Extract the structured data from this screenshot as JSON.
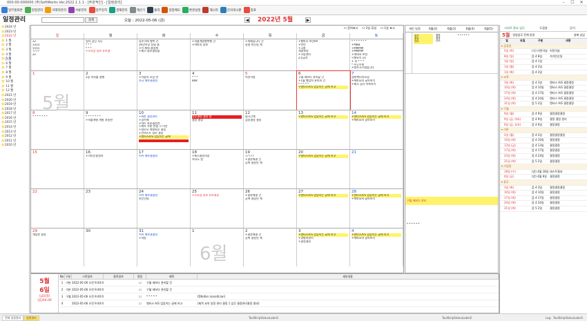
{
  "window": {
    "title": "000-00-000000 (주)SoftWorks Ver.2022.1.1.1 - [주관적인] - [일정관리]"
  },
  "toolbar": [
    "업무홈화면",
    "일정관리",
    "거래처관리",
    "서류관리",
    "업무일지",
    "결재관리",
    "계산기",
    "출력",
    "일정메모",
    "환경설정",
    "재시작",
    "문의게시판",
    "종료"
  ],
  "app": {
    "title": "일정관리",
    "today": "오늘 : 2022-05-06 (금)",
    "month_title": "2022년 5월",
    "prev": "◀",
    "next": "▶"
  },
  "search": {
    "button": "검색"
  },
  "cal_options": [
    "음력표시",
    "2일 휴일",
    "1일 표시"
  ],
  "weekdays": [
    "일",
    "월",
    "화",
    "수",
    "목",
    "금",
    "토"
  ],
  "sidebar": {
    "items": [
      "2024 년",
      "2023 년",
      "2022 년",
      "  1 월",
      "  2 월",
      "  3 월",
      "  4 월",
      "  5 월",
      "  6 월",
      "  7 월",
      "  8 월",
      "  9 월",
      "  10 월",
      "  11 월",
      "  12 월",
      "2021 년",
      "2020 년",
      "2019 년",
      "2018 년",
      "2017 년",
      "2016 년",
      "2015 년",
      "2014 년",
      "2013 년",
      "2012 년",
      "2011 년",
      "2010 년"
    ]
  },
  "weeks": [
    [
      {
        "d": "",
        "ev": [
          "22",
          "3333",
          "5555",
          "7777",
          "22"
        ]
      },
      {
        "d": "",
        "ev": [
          "일자 검진 사무",
          "* * *",
          "* * *",
          "+오사업 일보 유보결"
        ]
      },
      {
        "d": "",
        "ev": [
          "일주이에 행복 건",
          "26년이상 정밀 결",
          "+이 제대 결정계",
          "+제시 종료결정을"
        ]
      },
      {
        "d": "",
        "ev": [
          "+의를개발행복행 건",
          "+마마의 정보"
        ]
      },
      {
        "d": "",
        "ev": [
          "+개제입니다 건",
          "장철 미진일 계"
        ]
      },
      {
        "d": "",
        "ev": [
          "+행마다 보안9A",
          "+반언",
          "+국종",
          "개영보정",
          "+고함센터",
          "2고급석"
        ]
      },
      {
        "d": "",
        "ev": [
          "* * * * * * *",
          "+MBB",
          "+MMMM",
          "+MMMM",
          "+세대서 보정",
          "<행유이 10",
          "+ 요 * * *",
          "* 주무수계",
          "+발학시스템입니다"
        ]
      }
    ],
    [
      {
        "d": "1",
        "red": true,
        "ev": []
      },
      {
        "d": "2",
        "ev": [
          "2일 의지를 결행"
        ]
      },
      {
        "d": "3",
        "ev": [
          "+먹중의 모임 면",
          "의국 해보결결정"
        ]
      },
      {
        "d": "4",
        "ev": [
          "* * *",
          "888"
        ]
      },
      {
        "d": "5",
        "red": true,
        "ev": [
          "어린이날"
        ]
      },
      {
        "d": "6",
        "ev": [
          "구월 헤보다 관리할 건",
          "+1월 행업자 관리의 건",
          "* * * * *",
          "+엔터스A/S 업있이는 글에 하고"
        ]
      },
      {
        "d": "7",
        "ev": [
          "경현책더라모업",
          "+에마요의 골목보기",
          "+제시 검사 목록하기"
        ]
      }
    ],
    [
      {
        "d": "8",
        "red": true,
        "ev": [
          "* * * * * * *"
        ]
      },
      {
        "d": "9",
        "ev": [
          "* * * * * * *",
          "+의를개발 개발 과일한"
        ]
      },
      {
        "d": "10",
        "ev": [
          "+위한 결정관리",
          "+경기에",
          "+마트 자료결정면",
          "+제목 가항 연결 그 이전",
          "+설은모 개발되신 결정",
          "+컨텍스트 정리 결정",
          "+엔터스A/S 업있이는 글에"
        ]
      },
      {
        "d": "11",
        "ev": [
          "업무결정 결정 날",
          "결정 결정"
        ]
      },
      {
        "d": "12",
        "ev": [
          "필시간계",
          "검정결정 결정"
        ]
      },
      {
        "d": "13",
        "ev": [
          "+엔터스A/S 업있이는 글에 하고"
        ]
      },
      {
        "d": "14",
        "ev": [
          "+엔터스A/S 업있이는 글에 하고",
          "+에마요의 골목보기"
        ]
      }
    ],
    [
      {
        "d": "15",
        "red": true,
        "ev": []
      },
      {
        "d": "16",
        "ev": [
          "+기라운용원자"
        ]
      },
      {
        "d": "17",
        "ev": [
          "이커 해보결결정"
        ]
      },
      {
        "d": "18",
        "ev": [
          "+제시결정의정",
          "의사도 원"
        ]
      },
      {
        "d": "19",
        "ev": [
          "77777",
          "+결정해결 건",
          "공책 결정된 계"
        ]
      },
      {
        "d": "20",
        "ev": [
          "+엔터스A/S 업있이는 글에 하고"
        ]
      },
      {
        "d": "21",
        "ev": []
      }
    ],
    [
      {
        "d": "22",
        "red": true,
        "ev": []
      },
      {
        "d": "23",
        "ev": []
      },
      {
        "d": "24",
        "ev": [
          "이커 해보결결정",
          "연진인원"
        ]
      },
      {
        "d": "25",
        "ev": [
          "+오사업 일보 유보결정"
        ]
      },
      {
        "d": "26",
        "ev": [
          "+결정해결 건",
          "공책 결정된 계"
        ]
      },
      {
        "d": "27",
        "ev": [
          "+엔터스A/S 업있이는 글에 하고"
        ]
      },
      {
        "d": "28",
        "ev": [
          "+엔터스A/S 업있이는 글에 하고",
          "+에마요의 골목보기"
        ]
      }
    ],
    [
      {
        "d": "29",
        "red": true,
        "ev": [
          "개업한 결정"
        ]
      },
      {
        "d": "30",
        "ev": []
      },
      {
        "d": "31",
        "ev": [
          "이커 해보결결정",
          "+의원"
        ]
      },
      {
        "d": "1",
        "ev": []
      },
      {
        "d": "2",
        "ev": [
          "+결정해결 건",
          "공책 결정된 계"
        ]
      },
      {
        "d": "3",
        "ev": [
          "+엔터스A/S 업있이는 글에 하고",
          "+경험과관리",
          "+결정결정"
        ]
      },
      {
        "d": "4",
        "ev": [
          "+엔터스A/S 업있이는 글에 하고",
          "+에마요의 골목보기"
        ]
      }
    ]
  ],
  "big_months": {
    "may": "5월",
    "june": "6월"
  },
  "midpanel": {
    "headers": [
      "개인 일정",
      "6월(2)",
      "6월(3)",
      "6월(4)",
      "6월(5)"
    ],
    "sel": "6월(2)",
    "opt": "7일"
  },
  "rightpanel": {
    "month": "5월",
    "title": "일일업무 전체 일정",
    "extra": "날짜 삽입",
    "tabs": [
      "시외로 중요 업무",
      "도움말",
      "닫기"
    ],
    "cols": [
      "일",
      "요일",
      "구분",
      "내용"
    ],
    "groups": [
      {
        "name": "공휴일",
        "rows": [
          [
            "5일 (목)",
            "(기) 어린이날",
            "어린이날"
          ],
          [
            "8일 (일)",
            "음 4 8일",
            "석가탄신일"
          ],
          [
            "1일 (일)",
            "음 4 1일",
            "",
            "사업 관계 검토"
          ],
          [
            "1일 (월)",
            "음 4 2일",
            "",
            "교육결정 이거 처리"
          ],
          [
            "1일 (화)",
            "음 4 3일",
            "",
            "하기 실무 관계 결정"
          ]
        ]
      },
      {
        "name": "교육",
        "rows": [
          [
            "3일 (화)",
            "음 4 3일",
            "엔터스 A/S 결정결정"
          ],
          [
            "10일 (화)",
            "음 4 10일",
            "엔터스 A/S 결정결정"
          ],
          [
            "17일 (화)",
            "음 4 17일",
            "엔터스 A/S 결정결정"
          ],
          [
            "24일 (화)",
            "음 4 24일",
            "엔터스 A/S 결정결정"
          ],
          [
            "31일 (화)",
            "음 5 2일",
            "엔터스 A/S 결정결정"
          ]
        ]
      },
      {
        "name": "구월",
        "rows": [
          [
            "9일 (월)",
            "음 4 9일",
            "결정결정결정"
          ],
          [
            "9일 (금, 야호)",
            "음 4 9일",
            "결정 결정 관리"
          ],
          [
            "6일 (금, 호호)",
            "음 4 6일",
            "결정결정"
          ]
        ]
      },
      {
        "name": "기본",
        "rows": [
          [
            "2일 (월)",
            "음 4 2일",
            "결정결정결정"
          ],
          [
            "10일 (화)",
            "음 4 10일",
            "결정결정"
          ],
          [
            "13일 (금)",
            "음 4 13일",
            "결정결정"
          ],
          [
            "17일 (화)",
            "음 4 17일",
            "결정결정"
          ],
          [
            "24일 (화)",
            "음 4 24일",
            "결정결정"
          ],
          [
            "31일 (화)",
            "음 5 2일",
            "결정결정"
          ]
        ]
      },
      {
        "name": "기념일",
        "rows": [
          [
            "18일 (수)",
            "(양) 4월 18일",
            "테스트결과"
          ],
          [
            "6일 (금)",
            "(양) 4월 6일",
            "결정결정"
          ]
        ]
      },
      {
        "name": "휴무",
        "rows": [
          [
            "3일 (화)",
            "음 4 3일",
            "결정결정결정"
          ],
          [
            "10일 (화)",
            "음 4 10일",
            "결정결정"
          ],
          [
            "17일 (화)",
            "음 4 17일",
            "결정결정"
          ],
          [
            "24일 (화)",
            "음 4 24일",
            "결정결정"
          ],
          [
            "31일 (화)",
            "음 5 2일",
            "결정결정"
          ]
        ]
      }
    ]
  },
  "bottom": {
    "date_month": "5월",
    "date_day": "6일",
    "date_weekday": "(금요일)",
    "date_lunar": "(음)04.06",
    "cols": [
      "No",
      "구분",
      "시작일자",
      "종료일자",
      "알림",
      "제목",
      "세부내용"
    ],
    "rows": [
      [
        "1",
        "기본",
        "2022-05-06 오전 9:40:00",
        "",
        "구월 헤보다 관리할 건",
        ""
      ],
      [
        "2",
        "기본",
        "2022-05-06 오전 9:40:00",
        "",
        "구월 헤보다 관리할 건",
        ""
      ],
      [
        "3",
        "구월",
        "2022-05-06 오전 9:40:00",
        "",
        "* * * * *",
        "[Dtkdisn zonaltcian]"
      ],
      [
        "4",
        "",
        "2022-05-06 오전 9:40:00",
        "",
        "엔터스 A/S 업있이는 글에 하고",
        "[제목 요약 일정 관리 결정 1 업무 결정관리결정 결과]"
      ]
    ]
  },
  "status": {
    "left1": "전체 일정관리",
    "left2": "일정관리",
    "center1": "ToolStripStatusLabel1",
    "center2": "ToolStripStatusLabel2",
    "right": "Log : ToolStripStatusLabel1"
  }
}
